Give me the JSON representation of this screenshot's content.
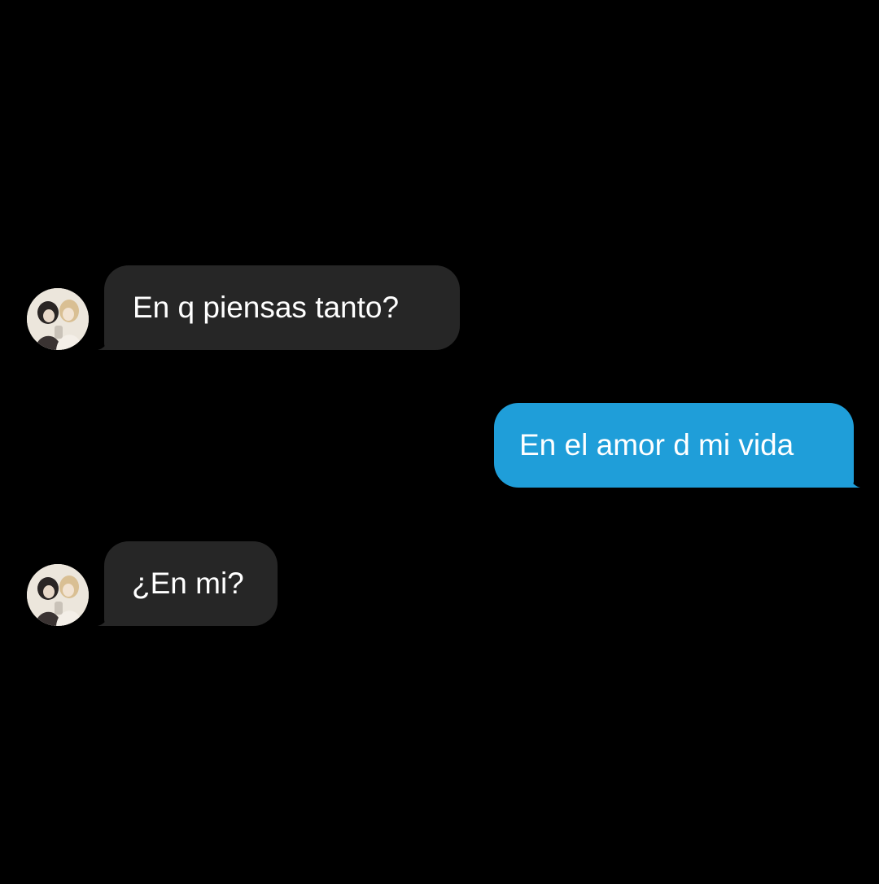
{
  "conversation": {
    "messages": [
      {
        "direction": "incoming",
        "text": "En q piensas tanto?"
      },
      {
        "direction": "outgoing",
        "text": "En el amor d mi vida"
      },
      {
        "direction": "incoming",
        "text": "¿En mi?"
      }
    ]
  },
  "colors": {
    "background": "#000000",
    "incoming_bubble": "#262626",
    "outgoing_bubble": "#1f9ed9",
    "text": "#ffffff"
  }
}
